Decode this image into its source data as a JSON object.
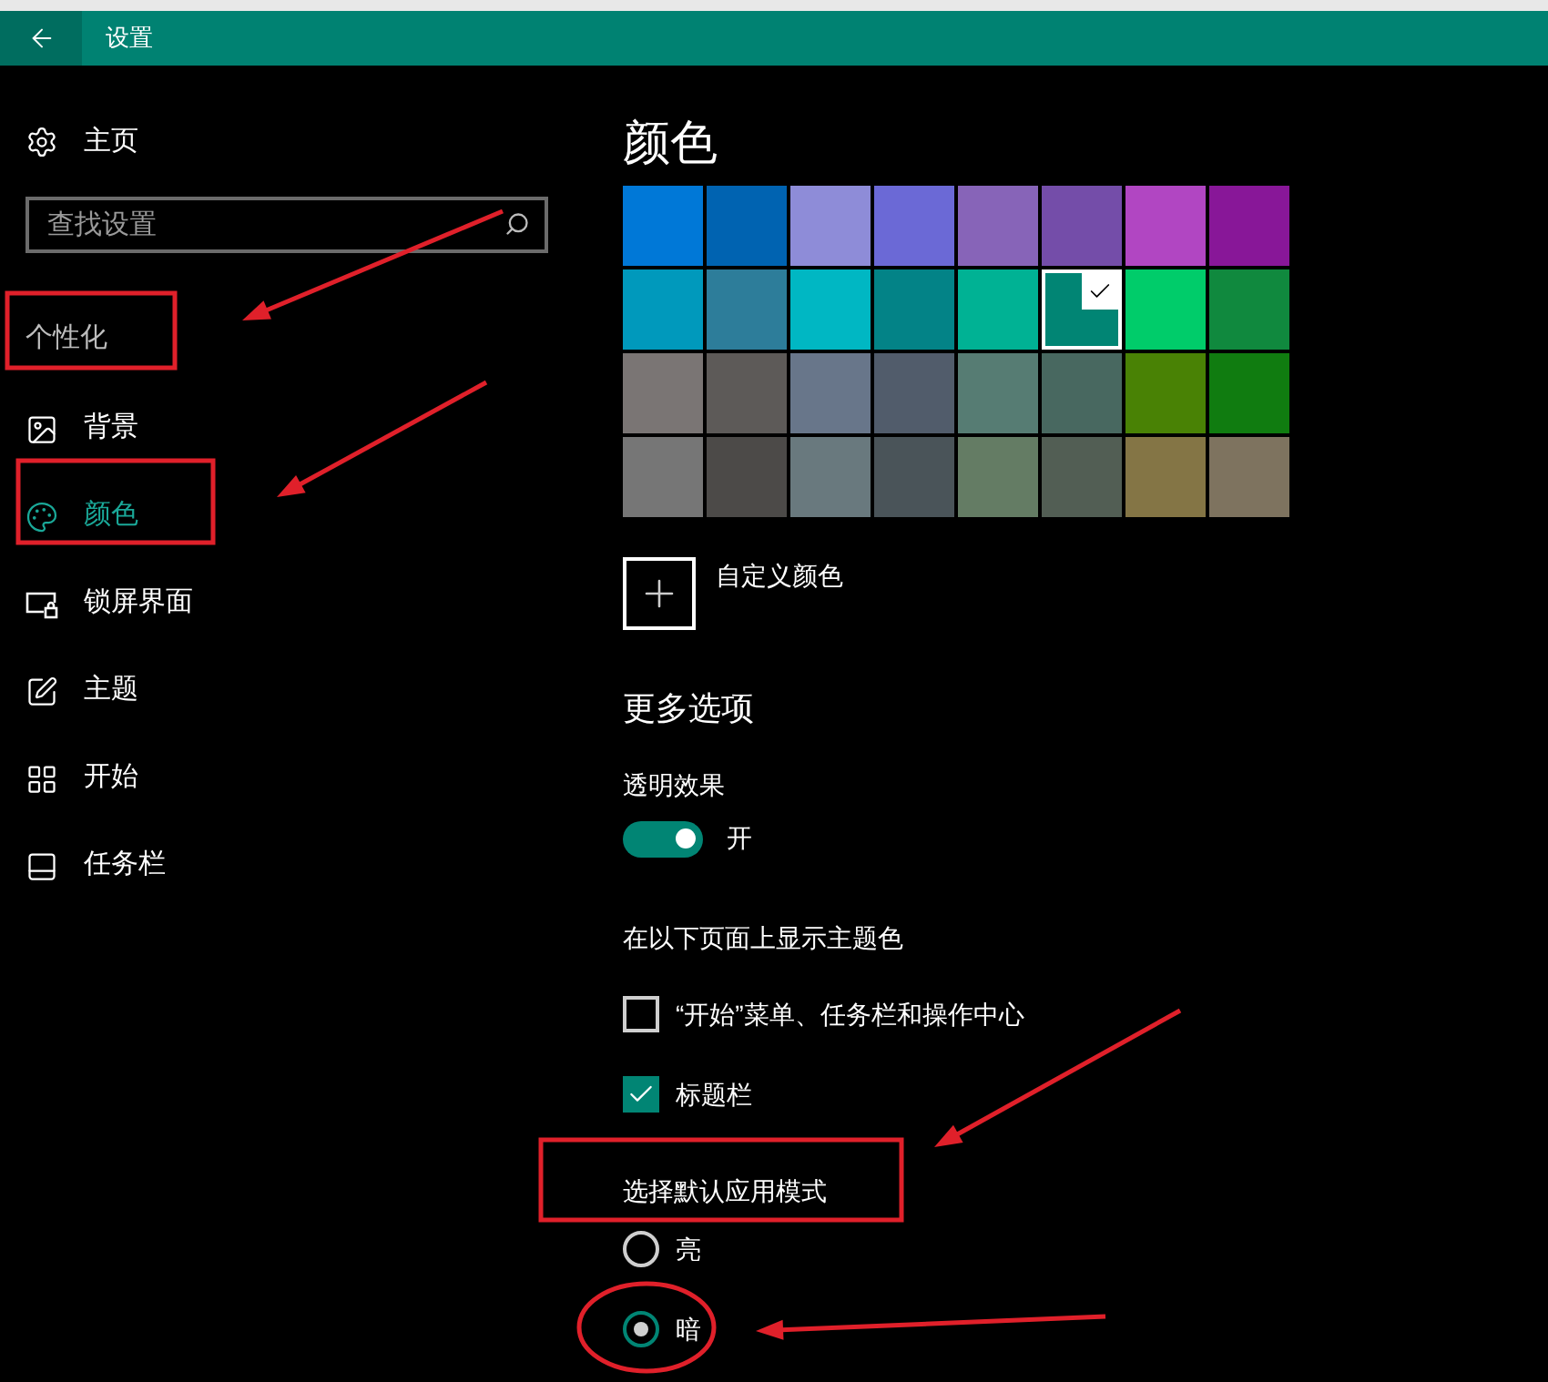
{
  "window": {
    "title": "设置"
  },
  "sidebar": {
    "home": {
      "label": "主页"
    },
    "search": {
      "placeholder": "查找设置"
    },
    "section": "个性化",
    "items": [
      {
        "kind": "background",
        "label": "背景",
        "selected": false
      },
      {
        "kind": "colors",
        "label": "颜色",
        "selected": true
      },
      {
        "kind": "lockscreen",
        "label": "锁屏界面",
        "selected": false
      },
      {
        "kind": "themes",
        "label": "主题",
        "selected": false
      },
      {
        "kind": "start",
        "label": "开始",
        "selected": false
      },
      {
        "kind": "taskbar",
        "label": "任务栏",
        "selected": false
      }
    ]
  },
  "content": {
    "title": "颜色",
    "swatches": [
      {
        "color": "#0078d7",
        "selected": false
      },
      {
        "color": "#0063b1",
        "selected": false
      },
      {
        "color": "#8e8cd8",
        "selected": false
      },
      {
        "color": "#6b69d6",
        "selected": false
      },
      {
        "color": "#8764b8",
        "selected": false
      },
      {
        "color": "#744da9",
        "selected": false
      },
      {
        "color": "#b146c2",
        "selected": false
      },
      {
        "color": "#881798",
        "selected": false
      },
      {
        "color": "#0099bc",
        "selected": false
      },
      {
        "color": "#2d7d9a",
        "selected": false
      },
      {
        "color": "#00b7c3",
        "selected": false
      },
      {
        "color": "#038387",
        "selected": false
      },
      {
        "color": "#00b294",
        "selected": false
      },
      {
        "color": "#018574",
        "selected": true
      },
      {
        "color": "#00cc6a",
        "selected": false
      },
      {
        "color": "#10893e",
        "selected": false
      },
      {
        "color": "#7a7574",
        "selected": false
      },
      {
        "color": "#5d5a58",
        "selected": false
      },
      {
        "color": "#68768a",
        "selected": false
      },
      {
        "color": "#515c6b",
        "selected": false
      },
      {
        "color": "#567c73",
        "selected": false
      },
      {
        "color": "#486860",
        "selected": false
      },
      {
        "color": "#498205",
        "selected": false
      },
      {
        "color": "#107c10",
        "selected": false
      },
      {
        "color": "#767676",
        "selected": false
      },
      {
        "color": "#4c4a48",
        "selected": false
      },
      {
        "color": "#69797e",
        "selected": false
      },
      {
        "color": "#4a5459",
        "selected": false
      },
      {
        "color": "#647c64",
        "selected": false
      },
      {
        "color": "#525e54",
        "selected": false
      },
      {
        "color": "#847545",
        "selected": false
      },
      {
        "color": "#7e735f",
        "selected": false
      }
    ],
    "custom_color": "自定义颜色",
    "more_options": "更多选项",
    "transparency": {
      "label": "透明效果",
      "on": true,
      "state_text": "开"
    },
    "accent_surfaces": {
      "label": "在以下页面上显示主题色",
      "options": [
        {
          "label": "“开始”菜单、任务栏和操作中心",
          "checked": false
        },
        {
          "label": "标题栏",
          "checked": true
        }
      ]
    },
    "app_mode": {
      "label": "选择默认应用模式",
      "options": [
        {
          "label": "亮",
          "selected": false
        },
        {
          "label": "暗",
          "selected": true
        }
      ]
    }
  }
}
